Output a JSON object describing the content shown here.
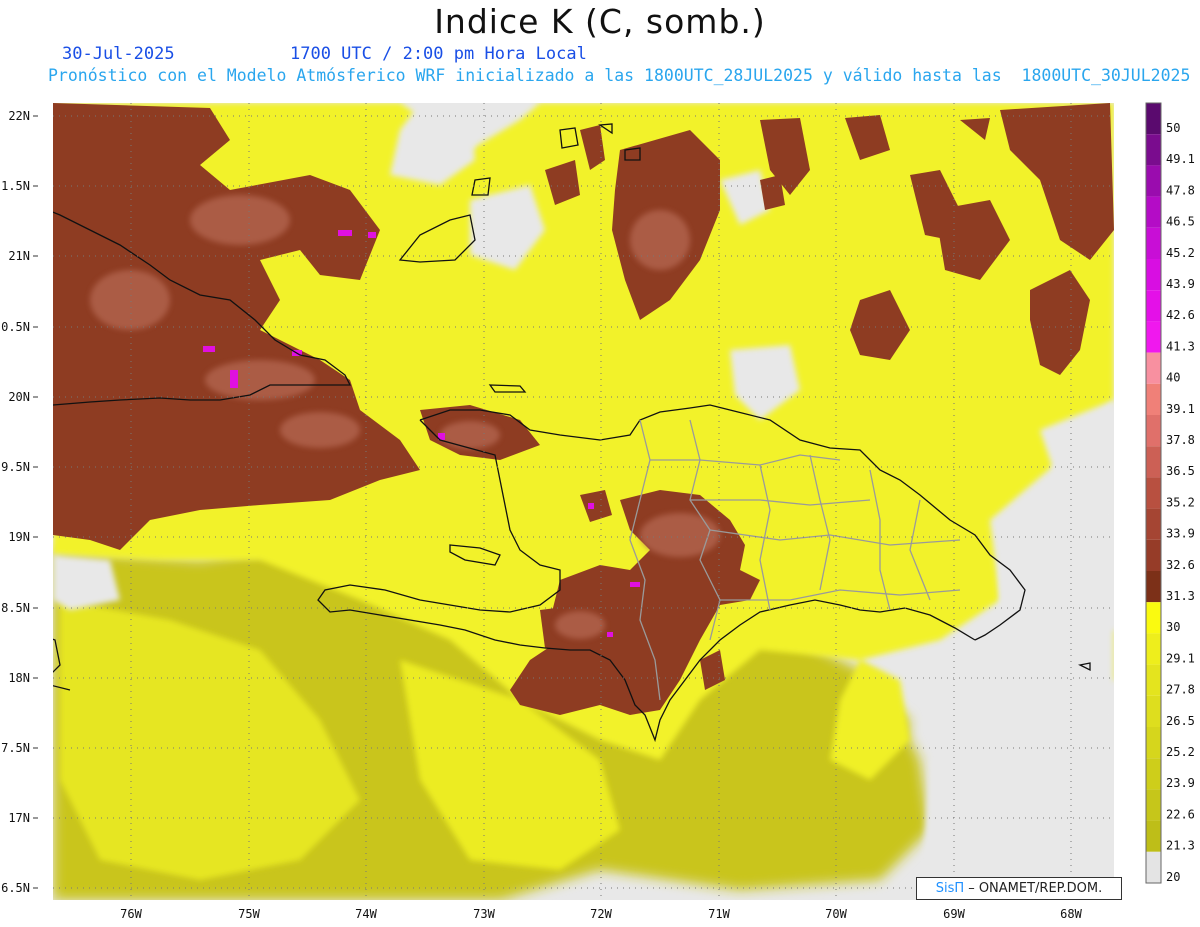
{
  "header": {
    "title": "Indice K (C, somb.)",
    "date": "30-Jul-2025",
    "valid_time": "1700 UTC / 2:00 pm Hora Local",
    "forecast_info": "Pronóstico con el Modelo Atmósferico WRF inicializado a las 1800UTC_28JUL2025 y válido hasta las  1800UTC_30JUL2025"
  },
  "map": {
    "lat_labels": [
      "22N",
      "1.5N",
      "21N",
      "0.5N",
      "20N",
      "9.5N",
      "19N",
      "8.5N",
      "18N",
      "7.5N",
      "17N",
      "6.5N"
    ],
    "lon_labels": [
      "76W",
      "75W",
      "74W",
      "73W",
      "72W",
      "71W",
      "70W",
      "69W",
      "68W"
    ],
    "colors": {
      "no_data": "#e8e8e8",
      "low": "#c8c41c",
      "mid": "#f0f028",
      "high": "#f8f800",
      "brown": "#8e3c22",
      "brown_light": "#b5624f",
      "magenta": "#e010e0"
    }
  },
  "colorbar": {
    "labels": [
      "50",
      "49.1",
      "47.8",
      "46.5",
      "45.2",
      "43.9",
      "42.6",
      "41.3",
      "40",
      "39.1",
      "37.8",
      "36.5",
      "35.2",
      "33.9",
      "32.6",
      "31.3",
      "30",
      "29.1",
      "27.8",
      "26.5",
      "25.2",
      "23.9",
      "22.6",
      "21.3",
      "20"
    ],
    "colors": [
      "#5a0a6e",
      "#7a0c8e",
      "#9a0cae",
      "#b40cc6",
      "#c80ed6",
      "#d80ee2",
      "#e410e8",
      "#f018ee",
      "#f890a0",
      "#f08078",
      "#e0706a",
      "#cc6055",
      "#b85040",
      "#a54533",
      "#963c28",
      "#7c3018",
      "#fafa10",
      "#eeee1c",
      "#e4e41e",
      "#dede1e",
      "#d6d61c",
      "#cece1a",
      "#c6c61a",
      "#bebe18",
      "#e4e4e4"
    ]
  },
  "credit": {
    "brand": "SisΠ",
    "org": "– ONAMET/REP.DOM."
  }
}
